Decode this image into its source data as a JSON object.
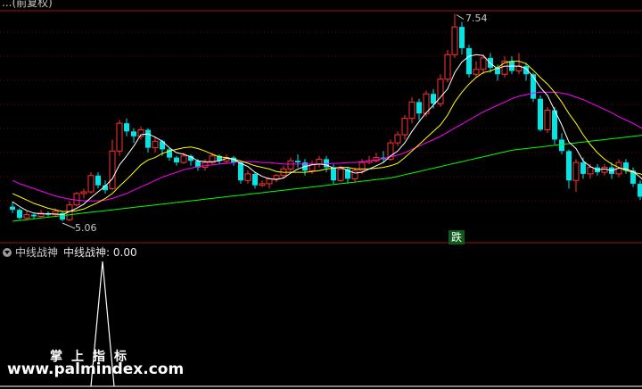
{
  "header": {
    "title_fragment": "...(前复权)"
  },
  "price_panel": {
    "high_label": "7.54",
    "low_label": "5.06",
    "signal_label": "跌",
    "colors": {
      "up": "#ff3232",
      "down": "#00e6e6",
      "ma5": "#ffffff",
      "ma10": "#ffff00",
      "ma20": "#ff00ff",
      "ma60": "#00ff00",
      "grid": "#7a0000"
    }
  },
  "indicator_panel": {
    "name": "中线战神",
    "value_label": "中线战神: 0.00",
    "signal_value": 1
  },
  "watermark": {
    "text_cn": "掌上指标",
    "url": "www.palmindex.com"
  },
  "chart_data": {
    "type": "candlestick",
    "price_range": [
      5.0,
      7.6
    ],
    "candles": [
      [
        5.18,
        5.14,
        5.24,
        5.1
      ],
      [
        5.14,
        5.04,
        5.16,
        5.02
      ],
      [
        5.04,
        5.08,
        5.12,
        5.02
      ],
      [
        5.08,
        5.06,
        5.1,
        5.03
      ],
      [
        5.06,
        5.1,
        5.14,
        5.05
      ],
      [
        5.1,
        5.08,
        5.12,
        5.06
      ],
      [
        5.08,
        5.12,
        5.16,
        5.06
      ],
      [
        5.1,
        5.02,
        5.12,
        5.0
      ],
      [
        5.02,
        5.2,
        5.25,
        5.0
      ],
      [
        5.2,
        5.34,
        5.36,
        5.18
      ],
      [
        5.34,
        5.36,
        5.4,
        5.28
      ],
      [
        5.36,
        5.56,
        5.6,
        5.34
      ],
      [
        5.56,
        5.44,
        5.6,
        5.4
      ],
      [
        5.44,
        5.38,
        5.5,
        5.34
      ],
      [
        5.4,
        5.86,
        6.0,
        5.38
      ],
      [
        5.86,
        6.2,
        6.24,
        5.8
      ],
      [
        6.2,
        6.1,
        6.26,
        6.04
      ],
      [
        6.1,
        6.04,
        6.14,
        5.96
      ],
      [
        6.04,
        6.12,
        6.16,
        6.0
      ],
      [
        6.12,
        5.9,
        6.14,
        5.84
      ],
      [
        5.9,
        5.98,
        6.04,
        5.84
      ],
      [
        5.98,
        5.88,
        6.0,
        5.8
      ],
      [
        5.88,
        5.78,
        5.9,
        5.74
      ],
      [
        5.78,
        5.72,
        5.8,
        5.68
      ],
      [
        5.72,
        5.8,
        5.84,
        5.7
      ],
      [
        5.8,
        5.74,
        5.82,
        5.68
      ],
      [
        5.74,
        5.66,
        5.76,
        5.62
      ],
      [
        5.66,
        5.72,
        5.76,
        5.62
      ],
      [
        5.72,
        5.8,
        5.84,
        5.7
      ],
      [
        5.8,
        5.74,
        5.82,
        5.7
      ],
      [
        5.74,
        5.78,
        5.82,
        5.7
      ],
      [
        5.78,
        5.72,
        5.8,
        5.68
      ],
      [
        5.72,
        5.5,
        5.74,
        5.46
      ],
      [
        5.5,
        5.58,
        5.62,
        5.46
      ],
      [
        5.58,
        5.44,
        5.6,
        5.4
      ],
      [
        5.44,
        5.46,
        5.5,
        5.42
      ],
      [
        5.46,
        5.52,
        5.54,
        5.4
      ],
      [
        5.52,
        5.56,
        5.58,
        5.48
      ],
      [
        5.56,
        5.64,
        5.68,
        5.52
      ],
      [
        5.64,
        5.74,
        5.78,
        5.6
      ],
      [
        5.74,
        5.72,
        5.82,
        5.66
      ],
      [
        5.72,
        5.62,
        5.76,
        5.56
      ],
      [
        5.62,
        5.7,
        5.74,
        5.58
      ],
      [
        5.7,
        5.76,
        5.8,
        5.66
      ],
      [
        5.76,
        5.66,
        5.8,
        5.6
      ],
      [
        5.66,
        5.5,
        5.7,
        5.46
      ],
      [
        5.5,
        5.64,
        5.68,
        5.48
      ],
      [
        5.64,
        5.52,
        5.66,
        5.46
      ],
      [
        5.52,
        5.62,
        5.66,
        5.48
      ],
      [
        5.62,
        5.72,
        5.76,
        5.58
      ],
      [
        5.72,
        5.74,
        5.8,
        5.7
      ],
      [
        5.74,
        5.78,
        5.84,
        5.72
      ],
      [
        5.78,
        5.76,
        5.86,
        5.72
      ],
      [
        5.76,
        5.96,
        6.0,
        5.74
      ],
      [
        5.96,
        6.06,
        6.1,
        5.92
      ],
      [
        6.06,
        6.26,
        6.3,
        6.0
      ],
      [
        6.26,
        6.46,
        6.52,
        6.2
      ],
      [
        6.46,
        6.32,
        6.5,
        6.24
      ],
      [
        6.32,
        6.56,
        6.6,
        6.28
      ],
      [
        6.56,
        6.44,
        6.62,
        6.38
      ],
      [
        6.44,
        6.74,
        6.8,
        6.4
      ],
      [
        6.74,
        7.04,
        7.1,
        6.7
      ],
      [
        7.04,
        7.38,
        7.54,
        7.0
      ],
      [
        7.38,
        7.12,
        7.44,
        7.04
      ],
      [
        7.12,
        6.8,
        7.16,
        6.76
      ],
      [
        6.8,
        6.86,
        6.96,
        6.76
      ],
      [
        6.86,
        7.0,
        7.04,
        6.8
      ],
      [
        7.0,
        6.88,
        7.06,
        6.82
      ],
      [
        6.88,
        6.8,
        6.92,
        6.72
      ],
      [
        6.8,
        6.96,
        7.02,
        6.76
      ],
      [
        6.96,
        6.84,
        7.02,
        6.8
      ],
      [
        6.84,
        6.9,
        7.06,
        6.8
      ],
      [
        6.9,
        6.8,
        6.94,
        6.72
      ],
      [
        6.8,
        6.5,
        6.82,
        6.46
      ],
      [
        6.5,
        6.12,
        6.54,
        6.1
      ],
      [
        6.12,
        6.36,
        6.4,
        6.08
      ],
      [
        6.36,
        6.0,
        6.4,
        5.94
      ],
      [
        6.0,
        5.86,
        6.08,
        5.82
      ],
      [
        5.86,
        5.5,
        5.88,
        5.4
      ],
      [
        5.5,
        5.72,
        5.76,
        5.36
      ],
      [
        5.72,
        5.58,
        5.78,
        5.52
      ],
      [
        5.58,
        5.66,
        5.7,
        5.52
      ],
      [
        5.66,
        5.6,
        5.7,
        5.56
      ],
      [
        5.6,
        5.66,
        5.7,
        5.56
      ],
      [
        5.66,
        5.58,
        5.72,
        5.52
      ],
      [
        5.58,
        5.72,
        5.76,
        5.54
      ],
      [
        5.72,
        5.62,
        5.76,
        5.58
      ],
      [
        5.62,
        5.46,
        5.66,
        5.42
      ],
      [
        5.46,
        5.3,
        5.5,
        5.26
      ],
      [
        5.3,
        5.18,
        5.34,
        5.14
      ]
    ],
    "ma5": [
      5.24,
      5.18,
      5.13,
      5.1,
      5.09,
      5.09,
      5.09,
      5.08,
      5.12,
      5.16,
      5.21,
      5.29,
      5.36,
      5.43,
      5.52,
      5.69,
      5.8,
      5.92,
      6.06,
      6.07,
      6.03,
      5.98,
      5.9,
      5.84,
      5.82,
      5.79,
      5.74,
      5.73,
      5.73,
      5.74,
      5.77,
      5.76,
      5.71,
      5.67,
      5.6,
      5.55,
      5.52,
      5.51,
      5.53,
      5.59,
      5.64,
      5.67,
      5.69,
      5.7,
      5.69,
      5.65,
      5.66,
      5.62,
      5.59,
      5.6,
      5.64,
      5.68,
      5.72,
      5.8,
      5.86,
      5.96,
      6.1,
      6.22,
      6.33,
      6.42,
      6.52,
      6.62,
      6.82,
      6.95,
      7.02,
      7.04,
      7.03,
      6.93,
      6.87,
      6.9,
      6.9,
      6.9,
      6.87,
      6.77,
      6.64,
      6.54,
      6.36,
      6.18,
      5.97,
      5.89,
      5.74,
      5.67,
      5.63,
      5.64,
      5.62,
      5.65,
      5.64,
      5.61,
      5.54,
      5.45
    ],
    "ma10": [
      5.34,
      5.3,
      5.26,
      5.22,
      5.19,
      5.16,
      5.14,
      5.12,
      5.12,
      5.13,
      5.15,
      5.19,
      5.23,
      5.28,
      5.34,
      5.43,
      5.51,
      5.6,
      5.69,
      5.75,
      5.78,
      5.83,
      5.86,
      5.88,
      5.9,
      5.91,
      5.89,
      5.86,
      5.82,
      5.79,
      5.78,
      5.76,
      5.74,
      5.71,
      5.68,
      5.66,
      5.64,
      5.61,
      5.6,
      5.6,
      5.6,
      5.6,
      5.61,
      5.62,
      5.64,
      5.65,
      5.66,
      5.66,
      5.64,
      5.64,
      5.64,
      5.65,
      5.66,
      5.68,
      5.71,
      5.78,
      5.86,
      5.94,
      6.02,
      6.1,
      6.18,
      6.3,
      6.46,
      6.58,
      6.68,
      6.76,
      6.82,
      6.84,
      6.88,
      6.94,
      6.96,
      6.96,
      6.93,
      6.85,
      6.76,
      6.68,
      6.58,
      6.46,
      6.32,
      6.2,
      6.06,
      5.94,
      5.84,
      5.76,
      5.7,
      5.66,
      5.62,
      5.6,
      5.58,
      5.55
    ],
    "ma20": [
      5.5,
      5.46,
      5.43,
      5.4,
      5.37,
      5.34,
      5.31,
      5.29,
      5.27,
      5.26,
      5.25,
      5.25,
      5.25,
      5.26,
      5.28,
      5.31,
      5.34,
      5.38,
      5.42,
      5.46,
      5.5,
      5.54,
      5.57,
      5.6,
      5.63,
      5.65,
      5.67,
      5.68,
      5.69,
      5.7,
      5.71,
      5.72,
      5.73,
      5.73,
      5.73,
      5.72,
      5.72,
      5.71,
      5.7,
      5.7,
      5.7,
      5.7,
      5.7,
      5.7,
      5.7,
      5.71,
      5.71,
      5.72,
      5.72,
      5.73,
      5.74,
      5.75,
      5.77,
      5.79,
      5.81,
      5.84,
      5.88,
      5.92,
      5.96,
      6.0,
      6.04,
      6.09,
      6.14,
      6.19,
      6.24,
      6.29,
      6.34,
      6.38,
      6.42,
      6.46,
      6.5,
      6.53,
      6.55,
      6.57,
      6.58,
      6.58,
      6.58,
      6.57,
      6.55,
      6.52,
      6.49,
      6.45,
      6.41,
      6.37,
      6.33,
      6.28,
      6.24,
      6.2,
      6.15,
      6.1
    ],
    "ma60": [
      5.0,
      5.01,
      5.02,
      5.03,
      5.04,
      5.05,
      5.06,
      5.07,
      5.08,
      5.09,
      5.1,
      5.11,
      5.12,
      5.13,
      5.14,
      5.15,
      5.16,
      5.17,
      5.18,
      5.19,
      5.2,
      5.21,
      5.22,
      5.23,
      5.24,
      5.25,
      5.26,
      5.27,
      5.28,
      5.29,
      5.3,
      5.31,
      5.32,
      5.33,
      5.34,
      5.35,
      5.36,
      5.37,
      5.38,
      5.39,
      5.4,
      5.41,
      5.42,
      5.43,
      5.44,
      5.45,
      5.46,
      5.47,
      5.48,
      5.49,
      5.5,
      5.51,
      5.52,
      5.53,
      5.55,
      5.57,
      5.59,
      5.61,
      5.63,
      5.65,
      5.67,
      5.69,
      5.71,
      5.73,
      5.75,
      5.77,
      5.79,
      5.81,
      5.83,
      5.85,
      5.87,
      5.88,
      5.89,
      5.9,
      5.91,
      5.92,
      5.93,
      5.94,
      5.95,
      5.96,
      5.97,
      5.98,
      5.99,
      6.0,
      6.01,
      6.02,
      6.03,
      6.04,
      6.05,
      6.06
    ],
    "indicator_range": [
      0,
      1
    ],
    "indicator_spike_index": 13
  }
}
